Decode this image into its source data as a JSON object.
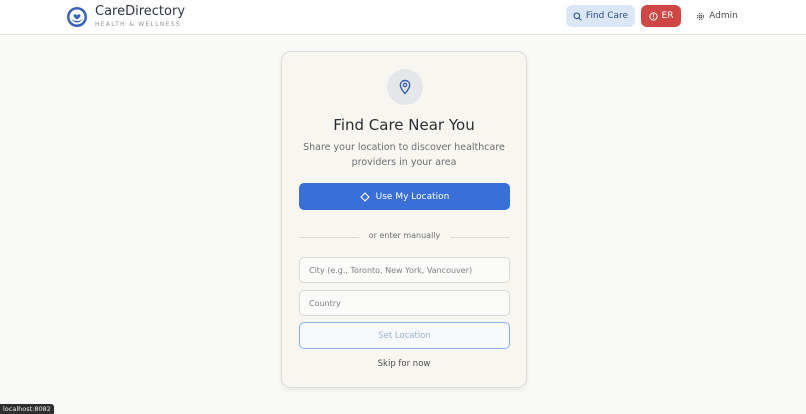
{
  "header": {
    "brand_name": "CareDirectory",
    "brand_tagline": "HEALTH & WELLNESS",
    "nav": {
      "find_care": "Find Care",
      "er": "ER",
      "admin": "Admin"
    }
  },
  "card": {
    "title": "Find Care Near You",
    "subtitle": "Share your location to discover healthcare providers in your area",
    "use_location_label": "Use My Location",
    "divider_text": "or enter manually",
    "city_placeholder": "City (e.g., Toronto, New York, Vancouver)",
    "country_placeholder": "Country",
    "set_location_label": "Set Location",
    "skip_label": "Skip for now"
  },
  "status_bar": {
    "url": "localhost:8082"
  },
  "colors": {
    "primary": "#3a6fd8",
    "er": "#cf4744",
    "find_care_bg": "#dbe7f7"
  },
  "icons": {
    "logo": "caredirectory-logo-icon",
    "find_care": "search-icon",
    "er": "alert-circle-icon",
    "admin": "gear-icon",
    "card_header": "map-pin-icon",
    "use_location": "crosshair-icon"
  }
}
